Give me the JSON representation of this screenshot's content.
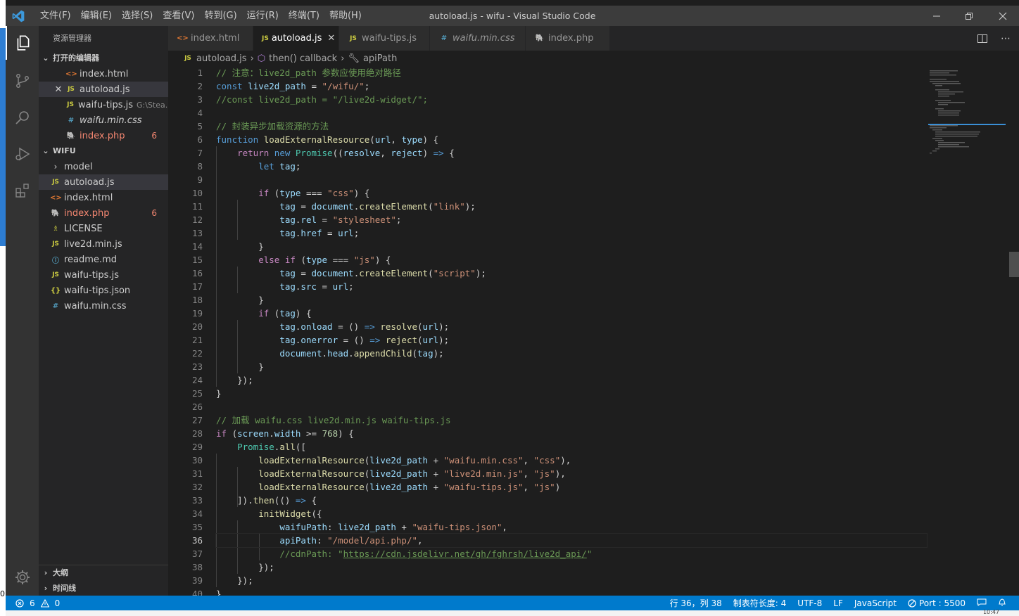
{
  "window": {
    "title": "autoload.js - wifu - Visual Studio Code",
    "menu": [
      "文件(F)",
      "编辑(E)",
      "选择(S)",
      "查看(V)",
      "转到(G)",
      "运行(R)",
      "终端(T)",
      "帮助(H)"
    ]
  },
  "edge": {
    "left_digit": "0",
    "bottom_text": "10:47"
  },
  "sidebar": {
    "title": "资源管理器",
    "open_editors_label": "打开的编辑器",
    "open_editors": [
      {
        "icon": "html-file-icon",
        "name": "index.html"
      },
      {
        "icon": "js-file-icon",
        "name": "autoload.js"
      },
      {
        "icon": "js-file-icon",
        "name": "waifu-tips.js",
        "path": "G:\\Stea..."
      },
      {
        "icon": "css-file-icon",
        "name": "waifu.min.css"
      },
      {
        "icon": "php-file-icon",
        "name": "index.php",
        "badge": "6"
      }
    ],
    "folder_label": "WIFU",
    "files": [
      {
        "icon": "folder-chevron-icon",
        "name": "model"
      },
      {
        "icon": "js-file-icon",
        "name": "autoload.js"
      },
      {
        "icon": "html-file-icon",
        "name": "index.html"
      },
      {
        "icon": "php-file-icon",
        "name": "index.php",
        "badge": "6"
      },
      {
        "icon": "license-file-icon",
        "name": "LICENSE"
      },
      {
        "icon": "js-file-icon",
        "name": "live2d.min.js"
      },
      {
        "icon": "info-file-icon",
        "name": "readme.md"
      },
      {
        "icon": "js-file-icon",
        "name": "waifu-tips.js"
      },
      {
        "icon": "json-file-icon",
        "name": "waifu-tips.json"
      },
      {
        "icon": "css-file-icon",
        "name": "waifu.min.css"
      }
    ],
    "outline_label": "大纲",
    "timeline_label": "时间线"
  },
  "tabs": [
    {
      "icon": "html-file-icon",
      "label": "index.html"
    },
    {
      "icon": "js-file-icon",
      "label": "autoload.js",
      "active": true
    },
    {
      "icon": "js-file-icon",
      "label": "waifu-tips.js"
    },
    {
      "icon": "css-file-icon",
      "label": "waifu.min.css"
    },
    {
      "icon": "php-file-icon",
      "label": "index.php"
    }
  ],
  "breadcrumb": {
    "file": "autoload.js",
    "symbol1": "then() callback",
    "symbol2": "apiPath"
  },
  "editor": {
    "language": "javascript",
    "cursor_line": 36,
    "line_numbers": [
      1,
      2,
      3,
      4,
      5,
      6,
      7,
      8,
      9,
      10,
      11,
      12,
      13,
      14,
      15,
      16,
      17,
      18,
      19,
      20,
      21,
      22,
      23,
      24,
      25,
      26,
      27,
      28,
      29,
      30,
      31,
      32,
      33,
      34,
      35,
      36,
      37,
      38,
      39,
      40
    ],
    "lines": [
      "// 注意：live2d_path 参数应使用绝对路径",
      "const live2d_path = \"/wifu/\";",
      "//const live2d_path = \"/live2d-widget/\";",
      "",
      "// 封装异步加载资源的方法",
      "function loadExternalResource(url, type) {",
      "    return new Promise((resolve, reject) => {",
      "        let tag;",
      "",
      "        if (type === \"css\") {",
      "            tag = document.createElement(\"link\");",
      "            tag.rel = \"stylesheet\";",
      "            tag.href = url;",
      "        }",
      "        else if (type === \"js\") {",
      "            tag = document.createElement(\"script\");",
      "            tag.src = url;",
      "        }",
      "        if (tag) {",
      "            tag.onload = () => resolve(url);",
      "            tag.onerror = () => reject(url);",
      "            document.head.appendChild(tag);",
      "        }",
      "    });",
      "}",
      "",
      "// 加载 waifu.css live2d.min.js waifu-tips.js",
      "if (screen.width >= 768) {",
      "    Promise.all([",
      "        loadExternalResource(live2d_path + \"waifu.min.css\", \"css\"),",
      "        loadExternalResource(live2d_path + \"live2d.min.js\", \"js\"),",
      "        loadExternalResource(live2d_path + \"waifu-tips.js\", \"js\")",
      "    ]).then(() => {",
      "        initWidget({",
      "            waifuPath: live2d_path + \"waifu-tips.json\",",
      "            apiPath: \"/model/api.php/\",",
      "            //cdnPath: \"https://cdn.jsdelivr.net/gh/fghrsh/live2d_api/\"",
      "        });",
      "    });",
      "}"
    ]
  },
  "status": {
    "problems_errors": "6",
    "problems_warnings": "0",
    "position": "行 36，列 38",
    "indent": "制表符长度: 4",
    "encoding": "UTF-8",
    "eol": "LF",
    "language": "JavaScript",
    "port": "Port : 5500"
  },
  "colors": {
    "accent": "#007acc",
    "titlebar": "#3c3c3c",
    "sidebar": "#252526",
    "editor_bg": "#1e1e1e",
    "error": "#f48771"
  }
}
